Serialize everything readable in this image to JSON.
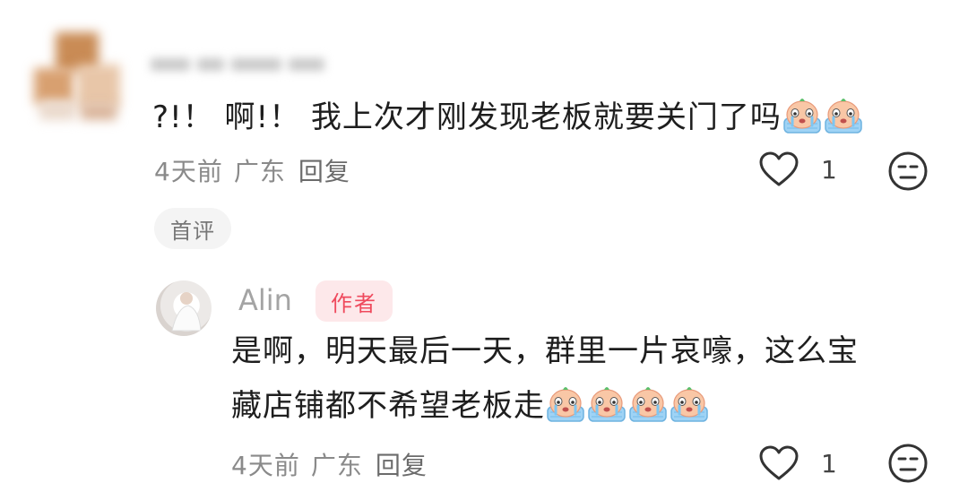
{
  "comment": {
    "text": "?!！ 啊!！ 我上次才刚发现老板就要关门了吗",
    "emoji_count": 2,
    "emoji_icon": "crying-face-emoji",
    "time": "4天前",
    "location": "广东",
    "reply_label": "回复",
    "likes": "1",
    "badge": "首评"
  },
  "reply": {
    "author": "Alin",
    "author_badge": "作者",
    "line1": "是啊，明天最后一天，群里一片哀嚎，这么宝",
    "line2": "藏店铺都不希望老板走",
    "emoji_count": 4,
    "time": "4天前",
    "location": "广东",
    "reply_label": "回复",
    "likes": "1"
  },
  "colors": {
    "badge_red": "#ef4a5d",
    "badge_bg": "#fde8ea",
    "meta_gray": "#8a8a8a"
  }
}
